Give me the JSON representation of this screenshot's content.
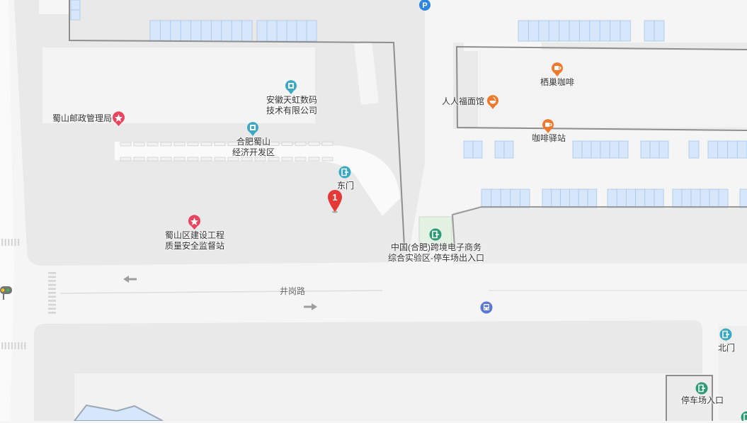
{
  "map": {
    "colors": {
      "background": "#f5f5f5",
      "block": "#e9e9e9",
      "building": "#f4f4f4",
      "parking_stall": "#d6e7fb",
      "boundary": "#8e8e8e",
      "road": "#fafafa",
      "marker_red": "#e53935",
      "poi_teal": "#3aa9c1",
      "poi_green": "#2e9a76",
      "poi_orange": "#ef7a2d",
      "poi_pink": "#e8465f",
      "poi_blue": "#2f86e0",
      "bus_blue": "#5b78d8"
    },
    "pois": {
      "anhui_tianhong": {
        "line1": "安徽天虹数码",
        "line2": "技术有限公司",
        "icon": "building-icon"
      },
      "shushan_post": {
        "label": "蜀山邮政管理局",
        "icon": "government-star-icon"
      },
      "hefei_shushan": {
        "line1": "合肥蜀山",
        "line2": "经济开发区",
        "icon": "building-icon"
      },
      "east_gate": {
        "label": "东门",
        "icon": "gate-icon"
      },
      "quality_station": {
        "line1": "蜀山区建设工程",
        "line2": "质量安全监督站",
        "icon": "government-star-icon"
      },
      "qichao_cafe": {
        "label": "栖巢咖啡",
        "icon": "coffee-icon"
      },
      "renren_noodles": {
        "label": "人人福面馆",
        "icon": "restaurant-icon"
      },
      "cafe_station": {
        "label": "咖啡驿站",
        "icon": "coffee-icon"
      },
      "ecommerce_parking": {
        "line1": "中国(合肥)跨境电子商务",
        "line2": "综合实验区-停车场出入口",
        "icon": "parking-entrance-icon"
      },
      "north_gate": {
        "label": "北门",
        "icon": "gate-icon"
      },
      "parking_entrance": {
        "label": "停车场入口",
        "icon": "parking-entrance-icon"
      }
    },
    "road": {
      "name": "井岗路"
    },
    "marker": {
      "number": "1"
    },
    "parking_sign": {
      "letter": "P"
    }
  }
}
